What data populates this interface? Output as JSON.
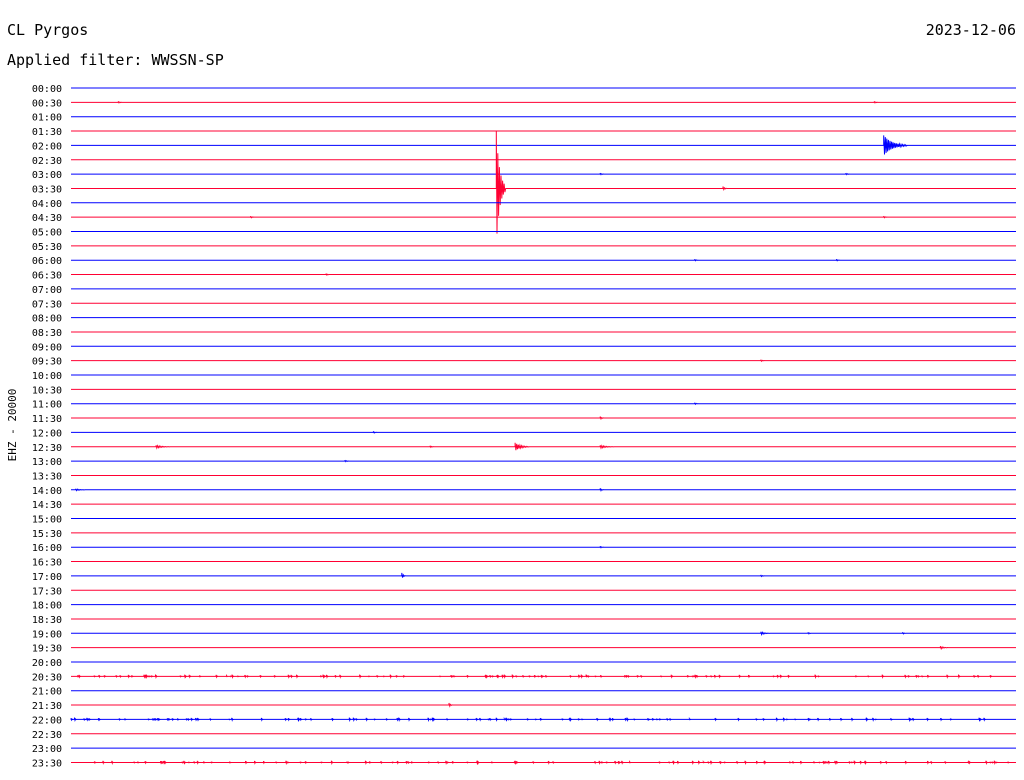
{
  "header": {
    "station": "CL Pyrgos",
    "date": "2023-12-06",
    "filter_label": "Applied filter: WWSSN-SP"
  },
  "chart_data": {
    "type": "line",
    "title": "CL Pyrgos",
    "subtitle": "Applied filter: WWSSN-SP",
    "ylabel": "EHZ - 20000",
    "xlabel": "",
    "grid": false,
    "line_colors": [
      "#0000ff",
      "#ff0033"
    ],
    "y_tick_labels": [
      "00:00",
      "00:30",
      "01:00",
      "01:30",
      "02:00",
      "02:30",
      "03:00",
      "03:30",
      "04:00",
      "04:30",
      "05:00",
      "05:30",
      "06:00",
      "06:30",
      "07:00",
      "07:30",
      "08:00",
      "08:30",
      "09:00",
      "09:30",
      "10:00",
      "10:30",
      "11:00",
      "11:30",
      "12:00",
      "12:30",
      "13:00",
      "13:30",
      "14:00",
      "14:30",
      "15:00",
      "15:30",
      "16:00",
      "16:30",
      "17:00",
      "17:30",
      "18:00",
      "18:30",
      "19:00",
      "19:30",
      "20:00",
      "20:30",
      "21:00",
      "21:30",
      "22:00",
      "22:30",
      "23:00",
      "23:30"
    ],
    "events": [
      {
        "row": 1,
        "at": 0.05,
        "amp": 1
      },
      {
        "row": 1,
        "at": 0.85,
        "amp": 1
      },
      {
        "row": 4,
        "at": 0.86,
        "amp": 10,
        "dur": 0.025
      },
      {
        "row": 6,
        "at": 0.56,
        "amp": 1
      },
      {
        "row": 6,
        "at": 0.82,
        "amp": 1
      },
      {
        "row": 7,
        "at": 0.45,
        "amp": 58,
        "dur": 0.01
      },
      {
        "row": 7,
        "at": 0.69,
        "amp": 2
      },
      {
        "row": 9,
        "at": 0.19,
        "amp": 1
      },
      {
        "row": 9,
        "at": 0.86,
        "amp": 1
      },
      {
        "row": 12,
        "at": 0.66,
        "amp": 1
      },
      {
        "row": 12,
        "at": 0.81,
        "amp": 1
      },
      {
        "row": 13,
        "at": 0.27,
        "amp": 1
      },
      {
        "row": 19,
        "at": 0.73,
        "amp": 1
      },
      {
        "row": 22,
        "at": 0.66,
        "amp": 1
      },
      {
        "row": 23,
        "at": 0.56,
        "amp": 1.5
      },
      {
        "row": 24,
        "at": 0.32,
        "amp": 1
      },
      {
        "row": 25,
        "at": 0.09,
        "amp": 1.5,
        "dur": 0.015
      },
      {
        "row": 25,
        "at": 0.38,
        "amp": 1
      },
      {
        "row": 25,
        "at": 0.47,
        "amp": 4,
        "dur": 0.015
      },
      {
        "row": 25,
        "at": 0.56,
        "amp": 1.5,
        "dur": 0.015
      },
      {
        "row": 26,
        "at": 0.29,
        "amp": 1
      },
      {
        "row": 28,
        "at": 0.005,
        "amp": 1,
        "dur": 0.01
      },
      {
        "row": 28,
        "at": 0.56,
        "amp": 1.5
      },
      {
        "row": 32,
        "at": 0.56,
        "amp": 1
      },
      {
        "row": 34,
        "at": 0.35,
        "amp": 3
      },
      {
        "row": 34,
        "at": 0.73,
        "amp": 1
      },
      {
        "row": 38,
        "at": 0.73,
        "amp": 1.5,
        "dur": 0.01
      },
      {
        "row": 38,
        "at": 0.78,
        "amp": 1
      },
      {
        "row": 38,
        "at": 0.88,
        "amp": 1
      },
      {
        "row": 39,
        "at": 0.92,
        "amp": 1.5,
        "dur": 0.008
      },
      {
        "row": 43,
        "at": 0.4,
        "amp": 2
      }
    ],
    "noisy_rows": [
      41,
      44,
      47
    ]
  }
}
